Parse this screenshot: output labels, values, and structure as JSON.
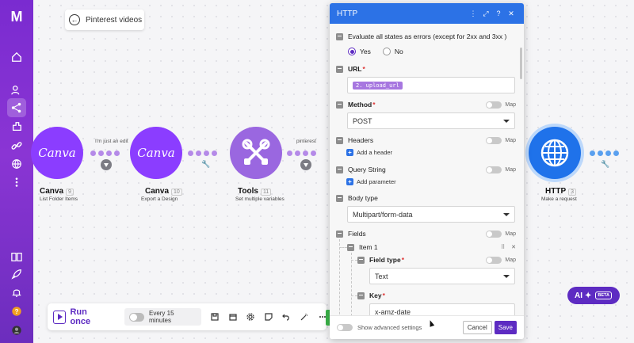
{
  "sidebar": {
    "logo": "M",
    "items": [
      {
        "name": "home-icon"
      },
      {
        "name": "team-icon"
      },
      {
        "name": "scenarios-icon",
        "active": true
      },
      {
        "name": "templates-icon"
      },
      {
        "name": "connections-icon"
      },
      {
        "name": "globe-icon"
      },
      {
        "name": "more-icon"
      },
      {
        "name": "docs-icon"
      },
      {
        "name": "rocket-icon"
      },
      {
        "name": "bell-icon"
      },
      {
        "name": "help-icon"
      },
      {
        "name": "profile-icon"
      }
    ]
  },
  "breadcrumb": {
    "back_icon": "arrow-left-icon",
    "title": "Pinterest videos"
  },
  "nodes": [
    {
      "app": "Canva",
      "logo_text": "Canva",
      "id": "9",
      "subtitle": "List Folder Items"
    },
    {
      "app": "Canva",
      "logo_text": "Canva",
      "id": "10",
      "subtitle": "Export a Design"
    },
    {
      "app": "Tools",
      "id": "11",
      "subtitle": "Set multiple variables"
    },
    {
      "app": "HTTP",
      "id": "3",
      "subtitle": "Make a request"
    }
  ],
  "connections": [
    {
      "label": "I'm just an edit"
    },
    {
      "label": "pinterest"
    }
  ],
  "toolbar": {
    "run_label": "Run once",
    "schedule_label": "Every 15 minutes"
  },
  "ai_button": {
    "label": "AI",
    "badge": "BETA"
  },
  "panel": {
    "title": "HTTP",
    "header_icons": [
      "more-icon",
      "expand-icon",
      "help-icon",
      "close-icon"
    ],
    "evaluate_label": "Evaluate all states as errors (except for 2xx and 3xx )",
    "radio_yes": "Yes",
    "radio_no": "No",
    "url_label": "URL",
    "url_value": "2. upload_url",
    "method_label": "Method",
    "method_value": "POST",
    "map_label": "Map",
    "headers_label": "Headers",
    "add_header": "Add a header",
    "query_label": "Query String",
    "add_parameter": "Add parameter",
    "body_type_label": "Body type",
    "body_type_value": "Multipart/form-data",
    "fields_label": "Fields",
    "item_label": "Item 1",
    "field_type_label": "Field type",
    "field_type_value": "Text",
    "key_label": "Key",
    "key_value": "x-amz-date",
    "show_advanced": "Show advanced settings",
    "cancel": "Cancel",
    "save": "Save"
  },
  "colors": {
    "brand": "#7a2bd0",
    "accent": "#5d2bc2",
    "http": "#2c72e6",
    "canva": "#8b3dff"
  }
}
